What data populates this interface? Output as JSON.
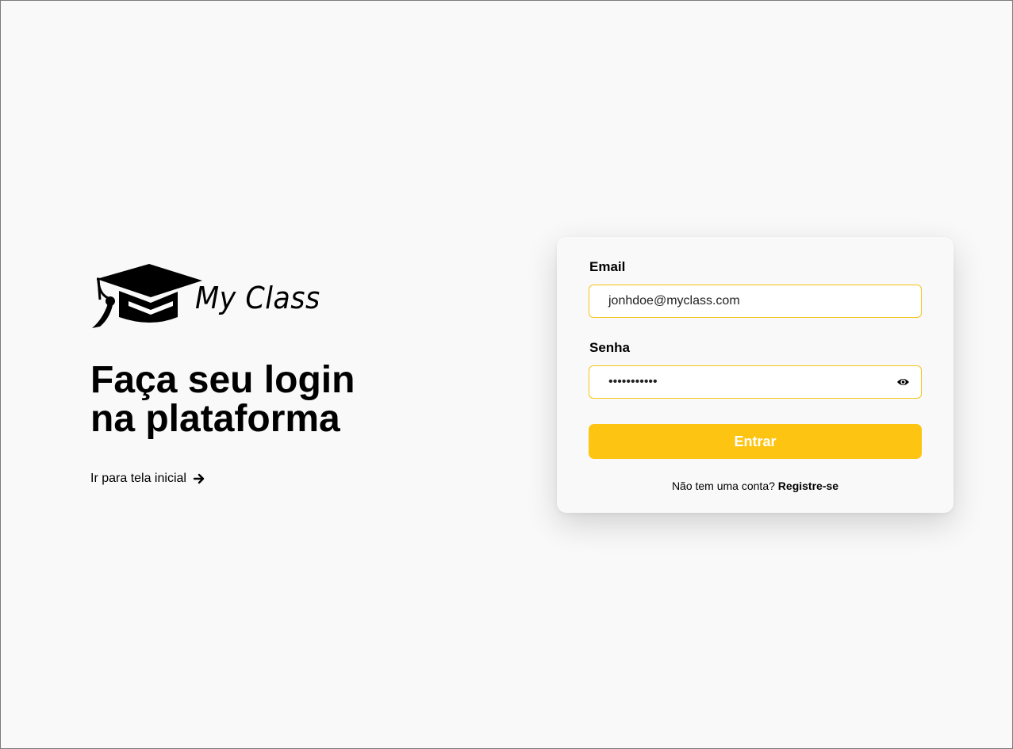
{
  "brand": {
    "name": "My Class",
    "logo_icon": "graduation-cap-icon"
  },
  "hero": {
    "headline_line1": "Faça seu login",
    "headline_line2": "na plataforma",
    "home_link": "Ir para tela inicial",
    "home_link_icon": "arrow-right-icon"
  },
  "form": {
    "email_label": "Email",
    "email_value": "jonhdoe@myclass.com",
    "password_label": "Senha",
    "password_value": "•••••••••••",
    "password_toggle_icon": "eye-icon",
    "submit_label": "Entrar",
    "signup_prompt": "Não tem uma conta?",
    "signup_link": "Registre-se"
  },
  "colors": {
    "background": "#f9f9f9",
    "accent": "#fdc412",
    "input_border": "#f5c518",
    "text": "#000000"
  }
}
